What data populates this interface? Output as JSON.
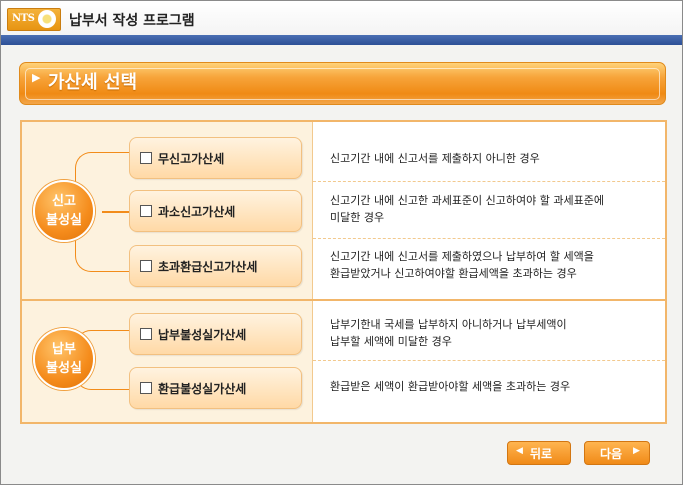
{
  "app": {
    "title": "납부서 작성 프로그램",
    "logo_text": "NTS"
  },
  "section": {
    "heading": "가산세 선택"
  },
  "groups": [
    {
      "label": "신고\n불성실",
      "items": [
        {
          "label": "무신고가산세",
          "checked": false,
          "description": "신고기간 내에 신고서를 제출하지 아니한 경우"
        },
        {
          "label": "과소신고가산세",
          "checked": false,
          "description": "신고기간 내에 신고한 과세표준이 신고하여야 할 과세표준에\n미달한  경우"
        },
        {
          "label": "초과환급신고가산세",
          "checked": false,
          "description": "신고기간 내에 신고서를 제출하였으나 납부하여 할 세액을\n환급받았거나 신고하여야할 환급세액을 초과하는 경우"
        }
      ]
    },
    {
      "label": "납부\n불성실",
      "items": [
        {
          "label": "납부불성실가산세",
          "checked": false,
          "description": "납부기한내 국세를 납부하지 아니하거나 납부세액이\n납부할 세액에 미달한 경우"
        },
        {
          "label": "환급불성실가산세",
          "checked": false,
          "description": "환급받은 세액이 환급받아야할 세액을 초과하는 경우"
        }
      ]
    }
  ],
  "buttons": {
    "back": "뒤로",
    "next": "다음"
  },
  "colors": {
    "accent": "#f08a14",
    "title_strip": "#2c4f96",
    "panel_border": "#f2b66a"
  }
}
